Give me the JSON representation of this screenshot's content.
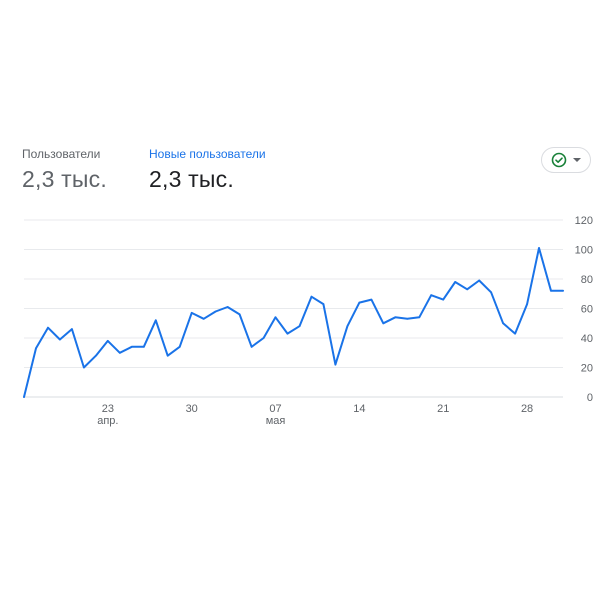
{
  "metrics": {
    "users": {
      "label": "Пользователи",
      "value": "2,3 тыс."
    },
    "new_users": {
      "label": "Новые пользователи",
      "value": "2,3 тыс."
    }
  },
  "status": {
    "icon": "check-circle-icon",
    "color": "#188038"
  },
  "chart_data": {
    "type": "line",
    "x_ticks": [
      {
        "day": 23,
        "label": "23",
        "sublabel": "апр."
      },
      {
        "day": 30,
        "label": "30",
        "sublabel": ""
      },
      {
        "day": 37,
        "label": "07",
        "sublabel": "мая"
      },
      {
        "day": 44,
        "label": "14",
        "sublabel": ""
      },
      {
        "day": 51,
        "label": "21",
        "sublabel": ""
      },
      {
        "day": 58,
        "label": "28",
        "sublabel": ""
      }
    ],
    "y_ticks": [
      0,
      20,
      40,
      60,
      80,
      100,
      120
    ],
    "ylim": [
      0,
      120
    ],
    "series": [
      {
        "color": "#1a73e8",
        "x": [
          16,
          17,
          18,
          19,
          20,
          21,
          22,
          23,
          24,
          25,
          26,
          27,
          28,
          29,
          30,
          31,
          32,
          33,
          34,
          35,
          36,
          37,
          38,
          39,
          40,
          41,
          42,
          43,
          44,
          45,
          46,
          47,
          48,
          49,
          50,
          51,
          52,
          53,
          54,
          55,
          56,
          57,
          58,
          59,
          60,
          61
        ],
        "y": [
          0,
          33,
          47,
          39,
          46,
          20,
          28,
          38,
          30,
          34,
          34,
          52,
          28,
          34,
          57,
          53,
          58,
          61,
          56,
          34,
          40,
          54,
          43,
          48,
          68,
          63,
          22,
          48,
          64,
          66,
          50,
          54,
          53,
          54,
          69,
          66,
          78,
          73,
          79,
          71,
          50,
          43,
          63,
          101,
          72,
          72
        ]
      }
    ]
  }
}
